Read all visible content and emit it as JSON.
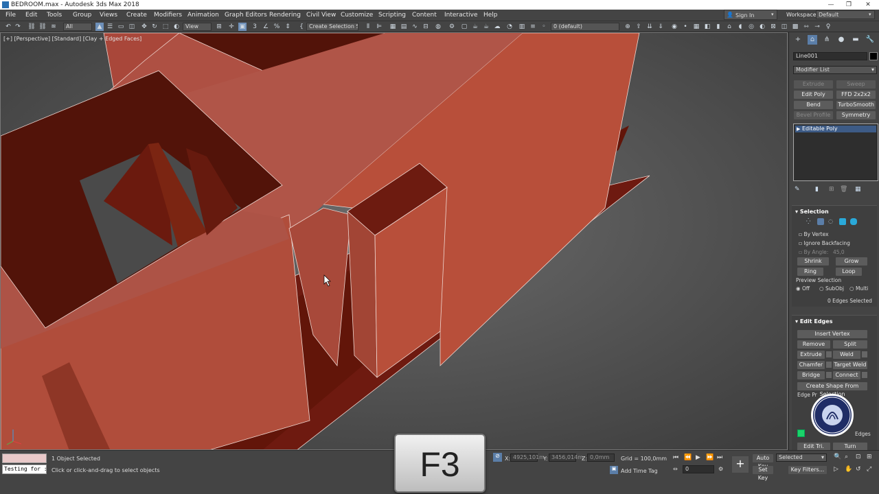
{
  "window": {
    "title": "BEDROOM.max - Autodesk 3ds Max 2018"
  },
  "menu": [
    "File",
    "Edit",
    "Tools",
    "Group",
    "Views",
    "Create",
    "Modifiers",
    "Animation",
    "Graph Editors",
    "Rendering",
    "Civil View",
    "Customize",
    "Scripting",
    "Content",
    "Interactive",
    "Help"
  ],
  "signin": {
    "label": "Sign In"
  },
  "workspaces": {
    "label": "Workspaces:",
    "value": "Default"
  },
  "toolbar": {
    "filter": "All",
    "refcoord": "View",
    "selset": "Create Selection Se",
    "layer": "0 (default)"
  },
  "viewport": {
    "label": "[+] [Perspective] [Standard] [Clay + Edged Faces]"
  },
  "panel": {
    "object_name": "Line001",
    "modifier_list": "Modifier List",
    "mod_buttons": [
      "Extrude",
      "Sweep",
      "Edit Poly",
      "FFD 2x2x2",
      "Bend",
      "TurboSmooth",
      "Bevel Profile",
      "Symmetry"
    ],
    "stack_item": "Editable Poly",
    "selection": {
      "title": "Selection",
      "by_vertex": "By Vertex",
      "ignore_backfacing": "Ignore Backfacing",
      "by_angle": "By Angle:",
      "angle_value": "45,0",
      "shrink": "Shrink",
      "grow": "Grow",
      "ring": "Ring",
      "loop": "Loop",
      "preview": "Preview Selection",
      "off": "Off",
      "subobj": "SubObj",
      "multi": "Multi",
      "status": "0 Edges Selected"
    },
    "edit_edges": {
      "title": "Edit Edges",
      "insert_vertex": "Insert Vertex",
      "remove": "Remove",
      "split": "Split",
      "extrude": "Extrude",
      "weld": "Weld",
      "chamfer": "Chamfer",
      "target_weld": "Target Weld",
      "bridge": "Bridge",
      "connect": "Connect",
      "create_shape": "Create Shape From Selection",
      "edge_props": "Edge Pr",
      "edges_label": "Edges",
      "edit_tri": "Edit Tri.",
      "turn": "Turn"
    }
  },
  "status": {
    "testing": "Testing for :",
    "selected": "1 Object Selected",
    "hint": "Click or click-and-drag to select objects",
    "x_label": "X:",
    "x_value": "4925,101m",
    "y_label": "Y:",
    "y_value": "3456,014m",
    "z_label": "Z:",
    "z_value": "0,0mm",
    "grid": "Grid = 100,0mm",
    "add_time_tag": "Add Time Tag",
    "frame": "0",
    "auto_key": "Auto Key",
    "set_key": "Set Key",
    "selected_dd": "Selected",
    "key_filters": "Key Filters..."
  },
  "overlay": {
    "key": "F3",
    "watermark": "XALQ TA'LIMI VAZIRLIGI UZBEK"
  }
}
